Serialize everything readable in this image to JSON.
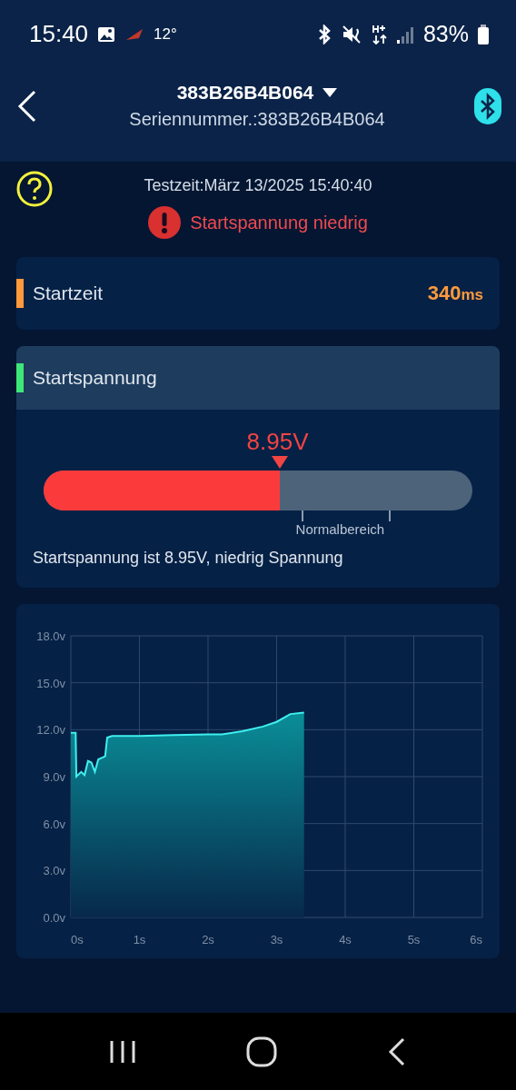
{
  "status_bar": {
    "time": "15:40",
    "temperature": "12°",
    "battery": "83%"
  },
  "header": {
    "title": "383B26B4B064",
    "subtitle": "Seriennummer.:383B26B4B064"
  },
  "test_time": "Testzeit:März 13/2025 15:40:40",
  "alert": "Startspannung niedrig",
  "start_time_card": {
    "label": "Startzeit",
    "value": "340",
    "unit": "ms",
    "color": "#ff9a3c"
  },
  "voltage_card": {
    "label": "Startspannung",
    "color": "#3ee878",
    "reading": "8.95V",
    "gauge": {
      "level": 0.55
    },
    "range_label": "Normalbereich",
    "summary": "Startspannung ist 8.95V, niedrig Spannung"
  },
  "chart": {
    "chart_data": {
      "type": "area",
      "x": [
        0,
        0.07,
        0.08,
        0.15,
        0.2,
        0.25,
        0.3,
        0.35,
        0.4,
        0.45,
        0.5,
        0.53,
        0.6,
        1.0,
        1.5,
        2.0,
        2.2,
        2.5,
        2.8,
        3.0,
        3.2,
        3.4
      ],
      "series": [
        {
          "color": "#3ff0f0",
          "values": [
            11.8,
            11.8,
            9.0,
            9.3,
            9.1,
            10.0,
            9.9,
            9.3,
            10.1,
            10.2,
            10.3,
            11.5,
            11.6,
            11.6,
            11.65,
            11.7,
            11.7,
            11.9,
            12.2,
            12.5,
            13.0,
            13.1
          ]
        }
      ],
      "xlim": [
        0,
        6
      ],
      "ylim": [
        0,
        18
      ],
      "grid": true,
      "xticks": [
        {
          "value": 0,
          "label": "0s"
        },
        {
          "value": 1,
          "label": "1s"
        },
        {
          "value": 2,
          "label": "2s"
        },
        {
          "value": 3,
          "label": "3s"
        },
        {
          "value": 4,
          "label": "4s"
        },
        {
          "value": 5,
          "label": "5s"
        },
        {
          "value": 6,
          "label": "6s"
        }
      ],
      "yticks": [
        {
          "value": 0,
          "label": "0.0v"
        },
        {
          "value": 3,
          "label": "3.0v"
        },
        {
          "value": 6,
          "label": "6.0v"
        },
        {
          "value": 9,
          "label": "9.0v"
        },
        {
          "value": 12,
          "label": "12.0v"
        },
        {
          "value": 15,
          "label": "15.0v"
        },
        {
          "value": 18,
          "label": "18.0v"
        }
      ]
    }
  }
}
